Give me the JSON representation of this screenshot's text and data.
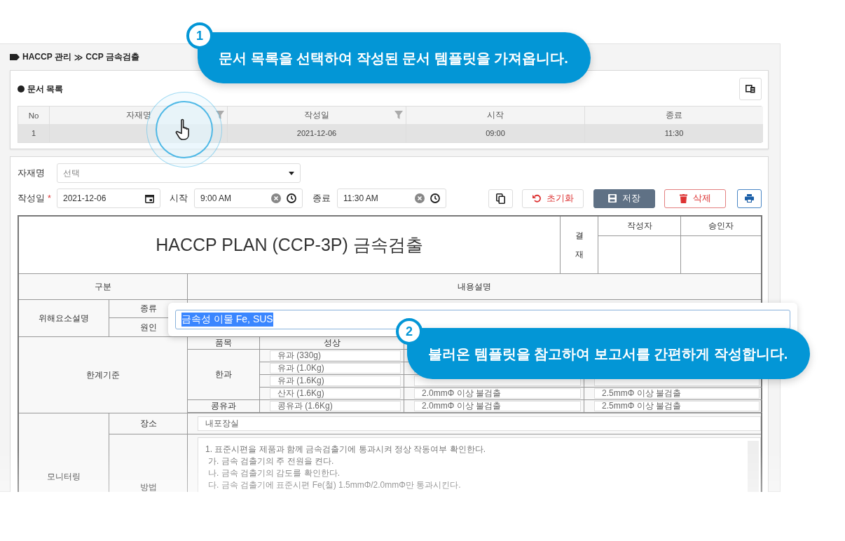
{
  "breadcrumb": {
    "items": [
      "HACCP 관리",
      "CCP 금속검출"
    ],
    "separator": "≫"
  },
  "doc_list": {
    "title": "문서 목록",
    "columns": [
      {
        "label": "No",
        "filter": false
      },
      {
        "label": "자재명",
        "filter": true
      },
      {
        "label": "작성일",
        "filter": true
      },
      {
        "label": "시작",
        "filter": false
      },
      {
        "label": "종료",
        "filter": false
      }
    ],
    "rows": [
      {
        "no": "1",
        "date": "2021-12-06",
        "start": "09:00",
        "end": "11:30",
        "selected": true
      }
    ]
  },
  "form": {
    "material": {
      "label": "자재명",
      "placeholder": "선택"
    },
    "date": {
      "label": "작성일",
      "required": true,
      "required_mark": "*",
      "value": "2021-12-06"
    },
    "start": {
      "label": "시작",
      "value": "9:00 AM"
    },
    "end": {
      "label": "종료",
      "value": "11:30 AM"
    },
    "buttons": [
      {
        "kind": "copy"
      },
      {
        "kind": "reset",
        "label": "초기화"
      },
      {
        "kind": "save",
        "label": "저장"
      },
      {
        "kind": "delete",
        "label": "삭제"
      },
      {
        "kind": "print"
      }
    ]
  },
  "plan": {
    "title": "HACCP PLAN (CCP-3P) 금속검출",
    "approval": "결재",
    "signers": [
      "작성자",
      "승인자"
    ],
    "header": [
      "구분",
      "내용설명"
    ],
    "hazard": {
      "label": "위해요소설명",
      "rows": [
        "종류",
        "원인"
      ]
    },
    "limit": {
      "label": "한계기준",
      "columns": [
        "품목",
        "성상"
      ],
      "groups": [
        {
          "item": "한과",
          "rows": [
            {
              "form": "유과 (330g)"
            },
            {
              "form": "유과 (1.0Kg)"
            },
            {
              "form": "유과 (1.6Kg)"
            },
            {
              "form": "산자 (1.6Kg)",
              "column_3": "2.0mmΦ 이상 불검출",
              "column_4": "2.5mmΦ 이상 불검출"
            }
          ]
        },
        {
          "item": "콩유과",
          "rows": [
            {
              "form": "콩유과 (1.6Kg)",
              "column_3": "2.0mmΦ 이상 불검출",
              "column_4": "2.5mmΦ 이상 불검출"
            }
          ]
        }
      ]
    },
    "monitoring": {
      "label": "모니터링",
      "place": {
        "label": "장소",
        "value": "내포장실"
      },
      "method": {
        "label": "방법",
        "lines": [
          "1. 표준시편을 제품과 함께 금속검출기에 통과시켜 정상 작동여부 확인한다.",
          "가. 금속 검출기의 주 전원을 켠다.",
          "나. 금속 검출기의 감도를 확인한다.",
          "다. 금속 검출기에 표준시편 Fe(철) 1.5mmΦ/2.0mmΦ만 통과시킨다."
        ]
      }
    }
  },
  "popup": {
    "value": "금속성 이물 Fe, SUS"
  },
  "callouts": [
    {
      "number": "1",
      "text": "문서 목록을 선택하여 작성된 문서 템플릿을 가져옵니다."
    },
    {
      "number": "2",
      "text": "불러온 템플릿을 참고하여 보고서를 간편하게 작성합니다."
    }
  ]
}
